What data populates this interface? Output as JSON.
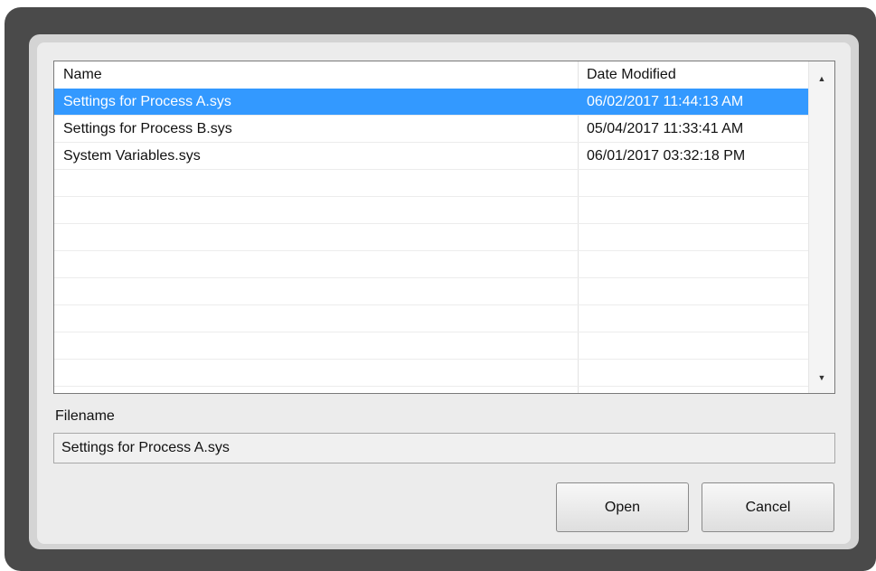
{
  "dialog": {
    "list": {
      "columns": [
        "Name",
        "Date Modified"
      ],
      "rows": [
        {
          "name": "Settings for Process A.sys",
          "date": "06/02/2017 11:44:13 AM",
          "selected": true
        },
        {
          "name": "Settings for Process B.sys",
          "date": "05/04/2017 11:33:41 AM",
          "selected": false
        },
        {
          "name": "System Variables.sys",
          "date": "06/01/2017 03:32:18 PM",
          "selected": false
        }
      ],
      "empty_row_count": 8,
      "scroll_up_icon": "triangle-up-icon",
      "scroll_down_icon": "triangle-down-icon"
    },
    "filename_label": "Filename",
    "filename_value": "Settings for Process A.sys",
    "buttons": {
      "open": "Open",
      "cancel": "Cancel"
    },
    "colors": {
      "selection": "#3399ff",
      "frame": "#4a4a4a",
      "panel": "#ececec"
    }
  }
}
